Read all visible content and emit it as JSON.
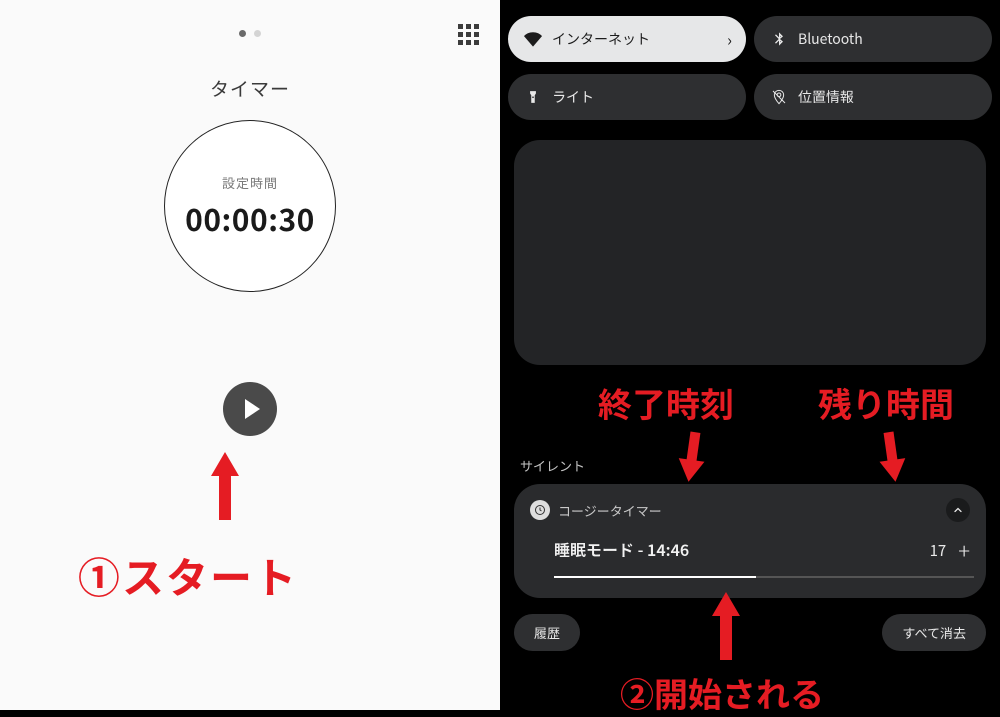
{
  "left": {
    "title": "タイマー",
    "set_label": "設定時間",
    "time_value": "00:00:30"
  },
  "right": {
    "qs": {
      "internet": "インターネット",
      "bluetooth": "Bluetooth",
      "light": "ライト",
      "location": "位置情報"
    },
    "silent": "サイレント",
    "notif": {
      "app": "コージータイマー",
      "title": "睡眠モード - 14:46",
      "remaining": "17"
    },
    "history": "履歴",
    "clear_all": "すべて消去"
  },
  "anno": {
    "start": "①スタート",
    "end_time": "終了時刻",
    "remaining": "残り時間",
    "begin": "②開始される"
  }
}
